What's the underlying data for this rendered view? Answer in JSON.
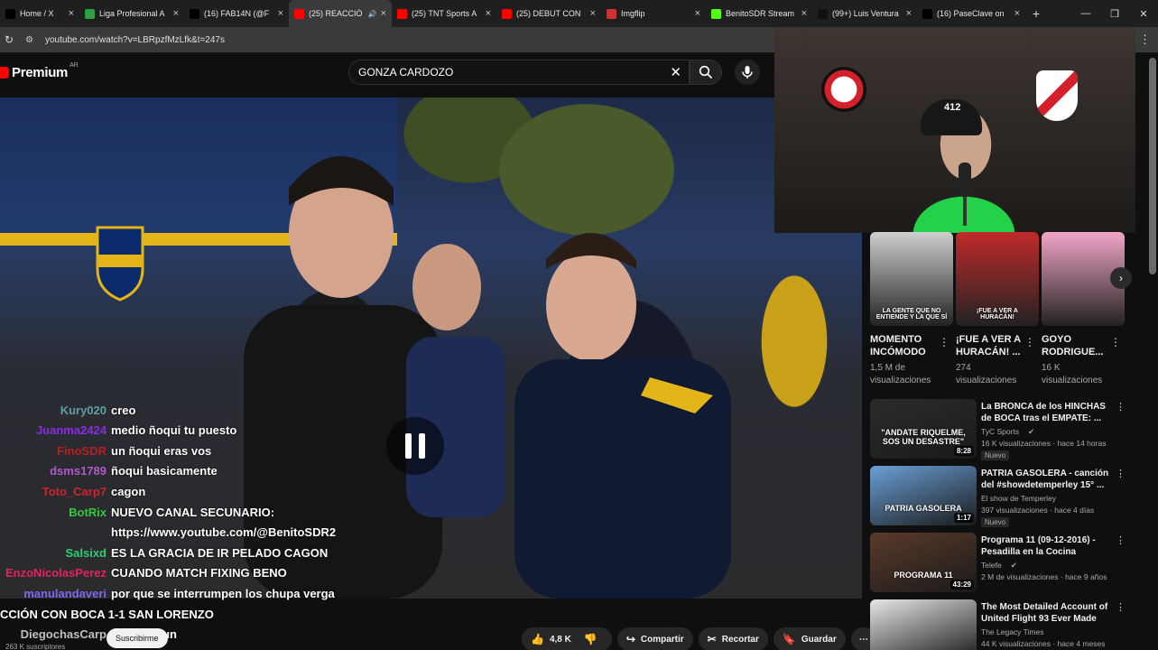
{
  "browser": {
    "tabs": [
      {
        "title": "Home / X",
        "color": "#000000",
        "active": false,
        "muted": false
      },
      {
        "title": "Liga Profesional A",
        "color": "#2ea043",
        "active": false,
        "muted": false
      },
      {
        "title": "(16) FAB14N (@F",
        "color": "#000000",
        "active": false,
        "muted": false
      },
      {
        "title": "(25) REACCIÓ",
        "color": "#ff0000",
        "active": true,
        "muted": true
      },
      {
        "title": "(25) TNT Sports A",
        "color": "#ff0000",
        "active": false,
        "muted": false
      },
      {
        "title": "(25) DEBUT CON",
        "color": "#ff0000",
        "active": false,
        "muted": false
      },
      {
        "title": "Imgflip",
        "color": "#cc3333",
        "active": false,
        "muted": false
      },
      {
        "title": "BenitoSDR Stream",
        "color": "#53fc18",
        "active": false,
        "muted": false
      },
      {
        "title": "(99+) Luis Ventura",
        "color": "#111111",
        "active": false,
        "muted": false
      },
      {
        "title": "(16) PaseClave on",
        "color": "#000000",
        "active": false,
        "muted": false
      }
    ],
    "new_tab": "+",
    "url": "youtube.com/watch?v=LBRpzfMzLfk&t=247s"
  },
  "youtube": {
    "logo_text": "Premium",
    "country_code": "AR",
    "search_query": "GONZA CARDOZO"
  },
  "player": {
    "chat": [
      {
        "nick": "Kury020",
        "color": "#5f9ea0",
        "msg": "creo"
      },
      {
        "nick": "Juanma2424",
        "color": "#8a2be2",
        "msg": "medio ñoqui tu puesto"
      },
      {
        "nick": "FinoSDR",
        "color": "#b22222",
        "msg": "un ñoqui eras vos"
      },
      {
        "nick": "dsms1789",
        "color": "#b05ac9",
        "msg": "ñoqui basicamente"
      },
      {
        "nick": "Toto_Carp7",
        "color": "#d2232a",
        "msg": "cagon"
      },
      {
        "nick": "BotRix",
        "color": "#2ecc40",
        "msg": "NUEVO CANAL SECUNARIO:"
      },
      {
        "nick": "",
        "color": "#ffffff",
        "msg": "https://www.youtube.com/@BenitoSDR2"
      },
      {
        "nick": "Salsixd",
        "color": "#2ecc71",
        "msg": "ES LA GRACIA DE IR PELADO CAGON"
      },
      {
        "nick": "EnzoNicolasPerez",
        "color": "#e0245e",
        "msg": "CUANDO MATCH FIXING BENO"
      },
      {
        "nick": "manulandaveri",
        "color": "#7b68ee",
        "msg": "por que se interrumpen los chupa verga"
      },
      {
        "nick": "",
        "color": "#ffffff",
        "msg": "CCIÓN CON",
        "overlap": "BOCA 1-1 SAN LORENZO"
      },
      {
        "nick": "DiegochasCarp",
        "color": "#c0c0c0",
        "msg": "famoso aun"
      }
    ],
    "subs_count": "263 K suscriptores",
    "subscribe_label": "Suscribirme",
    "actions": {
      "likes": "4,8 K",
      "share": "Compartir",
      "clip": "Recortar",
      "save": "Guardar",
      "more": "⋯"
    }
  },
  "webcam": {
    "cap_text": "412"
  },
  "shorts": [
    {
      "title": "MOMENTO INCÓMODO",
      "views": "1,5 M de visualizaciones",
      "caption": "LA GENTE QUE NO ENTIENDE Y LA QUE SÍ",
      "color": "#cfcfcf"
    },
    {
      "title": "¡FUE A VER A HURACÁN! ...",
      "views": "274 visualizaciones",
      "caption": "¡FUE A VER A HURACÁN!",
      "color": "#c12a2a"
    },
    {
      "title": "GOYO RODRIGUE...",
      "views": "16 K visualizaciones",
      "caption": "",
      "color": "#f2a6c8"
    }
  ],
  "recommendations": [
    {
      "title": "La BRONCA de los HINCHAS de BOCA tras el EMPATE: ...",
      "channel": "TyC Sports",
      "verified": true,
      "meta": "16 K visualizaciones · hace 14 horas",
      "badge": "Nuevo",
      "duration": "8:28",
      "thumb_text": "\"ANDATE RIQUELME, SOS UN DESASTRE\"",
      "color": "#2b2b2b"
    },
    {
      "title": "PATRIA GASOLERA - canción del #showdetemperley 15° ...",
      "channel": "El show de Temperley",
      "verified": false,
      "meta": "397 visualizaciones · hace 4 días",
      "badge": "Nuevo",
      "duration": "1:17",
      "thumb_text": "PATRIA GASOLERA",
      "color": "#6aa0d6"
    },
    {
      "title": "Programa 11 (09-12-2016) - Pesadilla en la Cocina",
      "channel": "Telefe",
      "verified": true,
      "meta": "2 M de visualizaciones · hace 9 años",
      "badge": "",
      "duration": "43:29",
      "thumb_text": "PROGRAMA 11",
      "color": "#5a3a2a"
    },
    {
      "title": "The Most Detailed Account of United Flight 93 Ever Made",
      "channel": "The Legacy Times",
      "verified": false,
      "meta": "44 K visualizaciones · hace 4 meses",
      "badge": "",
      "duration": "",
      "thumb_text": "",
      "color": "#e8e8e8"
    }
  ]
}
